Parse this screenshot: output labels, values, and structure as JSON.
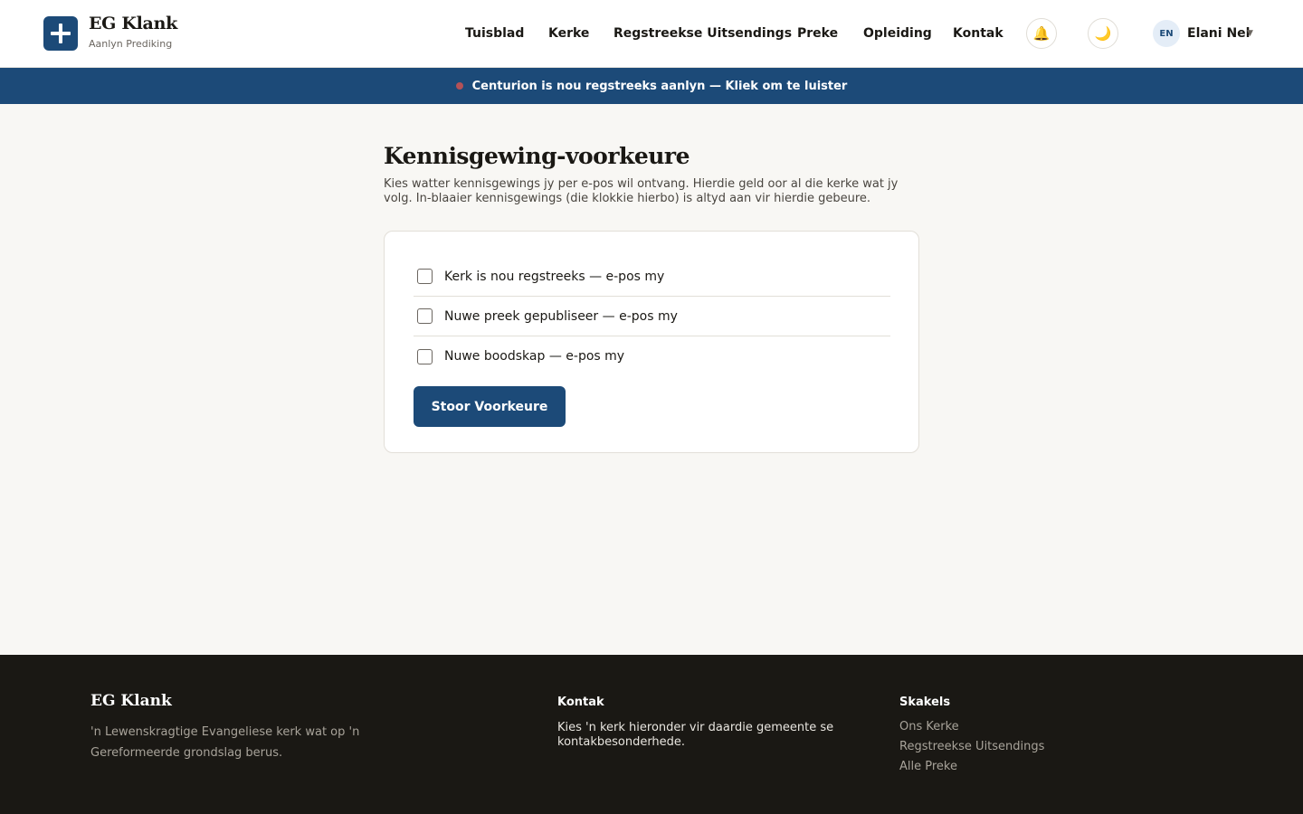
{
  "brand": {
    "name": "EG Klank",
    "subtitle": "Aanlyn Prediking"
  },
  "nav": {
    "items": [
      "Tuisblad",
      "Kerke",
      "Regstreekse Uitsendings",
      "Preke",
      "Opleiding",
      "Kontak"
    ]
  },
  "header": {
    "notifications_icon": "bell-icon",
    "theme_icon": "moon-icon",
    "user": {
      "initials": "EN",
      "name": "Elani Nel"
    }
  },
  "banner": {
    "text": "Centurion is nou regstreeks aanlyn — Kliek om te luister",
    "status_color": "#d9534f"
  },
  "main": {
    "title": "Kennisgewing-voorkeure",
    "description": "Kies watter kennisgewings jy per e-pos wil ontvang. Hierdie geld oor al die kerke wat jy volg. In-blaaier kennisgewings (die klokkie hierbo) is altyd aan vir hierdie gebeure.",
    "preferences": [
      {
        "label": "Kerk is nou regstreeks — e-pos my",
        "checked": false
      },
      {
        "label": "Nuwe preek gepubliseer — e-pos my",
        "checked": false
      },
      {
        "label": "Nuwe boodskap — e-pos my",
        "checked": false
      }
    ],
    "save_label": "Stoor Voorkeure"
  },
  "footer": {
    "brand": "EG Klank",
    "tagline": "'n Lewenskragtige Evangeliese kerk wat op 'n Gereformeerde grondslag berus.",
    "contact": {
      "heading": "Kontak",
      "text": "Kies 'n kerk hieronder vir daardie gemeente se kontakbesonderhede."
    },
    "links": {
      "heading": "Skakels",
      "items": [
        "Ons Kerke",
        "Regstreekse Uitsendings",
        "Alle Preke"
      ]
    }
  },
  "colors": {
    "primary": "#1c4a78",
    "background": "#f8f7f4",
    "footer": "#1a1814"
  }
}
